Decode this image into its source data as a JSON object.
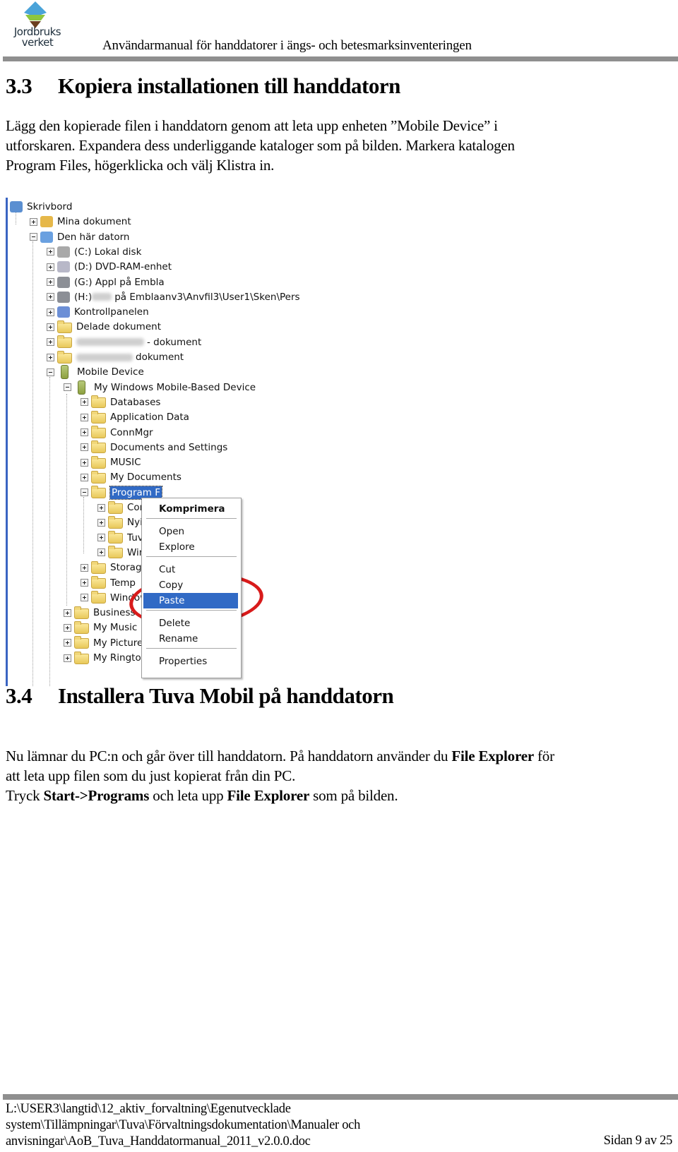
{
  "header": {
    "logo_line1": "Jordbruks",
    "logo_line2": "verket",
    "title": "Användarmanual för handdatorer i ängs- och betesmarksinventeringen",
    "colors": {
      "rule": "#8f8f8f",
      "logo_blue": "#4aa3d9",
      "logo_green": "#8dc63f",
      "logo_brown": "#6b3f1f"
    }
  },
  "section_33": {
    "number": "3.3",
    "title": "Kopiera installationen till handdatorn",
    "paragraph_lines": [
      "Lägg den kopierade filen i handdatorn genom att leta upp enheten ”Mobile Device” i",
      "utforskaren. Expandera dess underliggande kataloger som på bilden. Markera katalogen",
      "Program Files, högerklicka och välj Klistra in."
    ]
  },
  "screenshot": {
    "tree": [
      {
        "label": "Skrivbord",
        "icon": "desktop-icon",
        "expander": "none"
      },
      {
        "label": "Mina dokument",
        "icon": "my-documents-icon",
        "expander": "plus"
      },
      {
        "label": "Den här datorn",
        "icon": "my-computer-icon",
        "expander": "minus"
      },
      {
        "label": "(C:) Lokal disk",
        "icon": "hard-drive-icon",
        "expander": "plus"
      },
      {
        "label": "(D:) DVD-RAM-enhet",
        "icon": "dvd-drive-icon",
        "expander": "plus"
      },
      {
        "label": "(G:) Appl på Embla",
        "icon": "network-drive-icon",
        "expander": "plus"
      },
      {
        "label_prefix": "(H:)",
        "label": "på Emblaanv3\\Anvfil3\\User1\\Sken\\Pers",
        "icon": "network-drive-icon",
        "expander": "plus",
        "redacted": true
      },
      {
        "label": "Kontrollpanelen",
        "icon": "control-panel-icon",
        "expander": "plus"
      },
      {
        "label": "Delade dokument",
        "icon": "folder-icon",
        "expander": "plus"
      },
      {
        "label": "- dokument",
        "icon": "folder-icon",
        "expander": "plus",
        "redacted": true
      },
      {
        "label": "dokument",
        "icon": "folder-icon",
        "expander": "plus",
        "redacted": true
      },
      {
        "label": "Mobile Device",
        "icon": "mobile-device-icon",
        "expander": "minus"
      },
      {
        "label": "My Windows Mobile-Based Device",
        "icon": "mobile-device-icon",
        "expander": "minus"
      },
      {
        "label": "Databases",
        "icon": "database-folder-icon",
        "expander": "plus"
      },
      {
        "label": "Application Data",
        "icon": "folder-icon",
        "expander": "plus"
      },
      {
        "label": "ConnMgr",
        "icon": "folder-icon",
        "expander": "plus"
      },
      {
        "label": "Documents and Settings",
        "icon": "folder-icon",
        "expander": "plus"
      },
      {
        "label": "MUSIC",
        "icon": "folder-icon",
        "expander": "plus"
      },
      {
        "label": "My Documents",
        "icon": "folder-icon",
        "expander": "plus"
      },
      {
        "label": "Program F",
        "icon": "open-folder-icon",
        "expander": "minus",
        "selected": true
      },
      {
        "label": "Conne",
        "icon": "folder-icon",
        "expander": "plus"
      },
      {
        "label": "Nyinst",
        "icon": "folder-icon",
        "expander": "plus"
      },
      {
        "label": "TuvaM",
        "icon": "folder-icon",
        "expander": "plus"
      },
      {
        "label": "Windo",
        "icon": "folder-icon",
        "expander": "plus"
      },
      {
        "label": "Storage C",
        "icon": "folder-icon",
        "expander": "plus"
      },
      {
        "label": "Temp",
        "icon": "folder-icon",
        "expander": "plus"
      },
      {
        "label": "Windows",
        "icon": "folder-icon",
        "expander": "plus"
      },
      {
        "label": "Business",
        "icon": "folder-icon",
        "expander": "plus"
      },
      {
        "label": "My Music",
        "icon": "folder-icon",
        "expander": "plus"
      },
      {
        "label": "My Pictures",
        "icon": "folder-icon",
        "expander": "plus"
      },
      {
        "label": "My Ringtones",
        "icon": "folder-icon",
        "expander": "plus"
      }
    ],
    "context_menu": {
      "items": [
        {
          "label": "Komprimera",
          "bold": true
        },
        {
          "label": "Open"
        },
        {
          "label": "Explore"
        },
        {
          "label": "Cut"
        },
        {
          "label": "Copy"
        },
        {
          "label": "Paste",
          "highlighted": true
        },
        {
          "label": "Delete"
        },
        {
          "label": "Rename"
        },
        {
          "label": "Properties"
        }
      ],
      "highlight_color": "#316ac5",
      "annotation_color": "#d81b1b"
    }
  },
  "section_34": {
    "number": "3.4",
    "title": "Installera Tuva Mobil på handdatorn",
    "line1_a": "Nu lämnar du PC:n och går över till handdatorn. På handdatorn använder du ",
    "line1_b": "File Explorer",
    "line1_c": " för",
    "line2": "att leta upp filen som du just kopierat från din PC.",
    "line3_a": "Tryck ",
    "line3_b": "Start->Programs",
    "line3_c": " och leta upp ",
    "line3_d": "File Explorer",
    "line3_e": " som på bilden."
  },
  "footer": {
    "path_lines": [
      "L:\\USER3\\langtid\\12_aktiv_forvaltning\\Egenutvecklade",
      "system\\Tillämpningar\\Tuva\\Förvaltningsdokumentation\\Manualer och",
      "anvisningar\\AoB_Tuva_Handdatormanual_2011_v2.0.0.doc"
    ],
    "page_label": "Sidan 9 av 25"
  }
}
